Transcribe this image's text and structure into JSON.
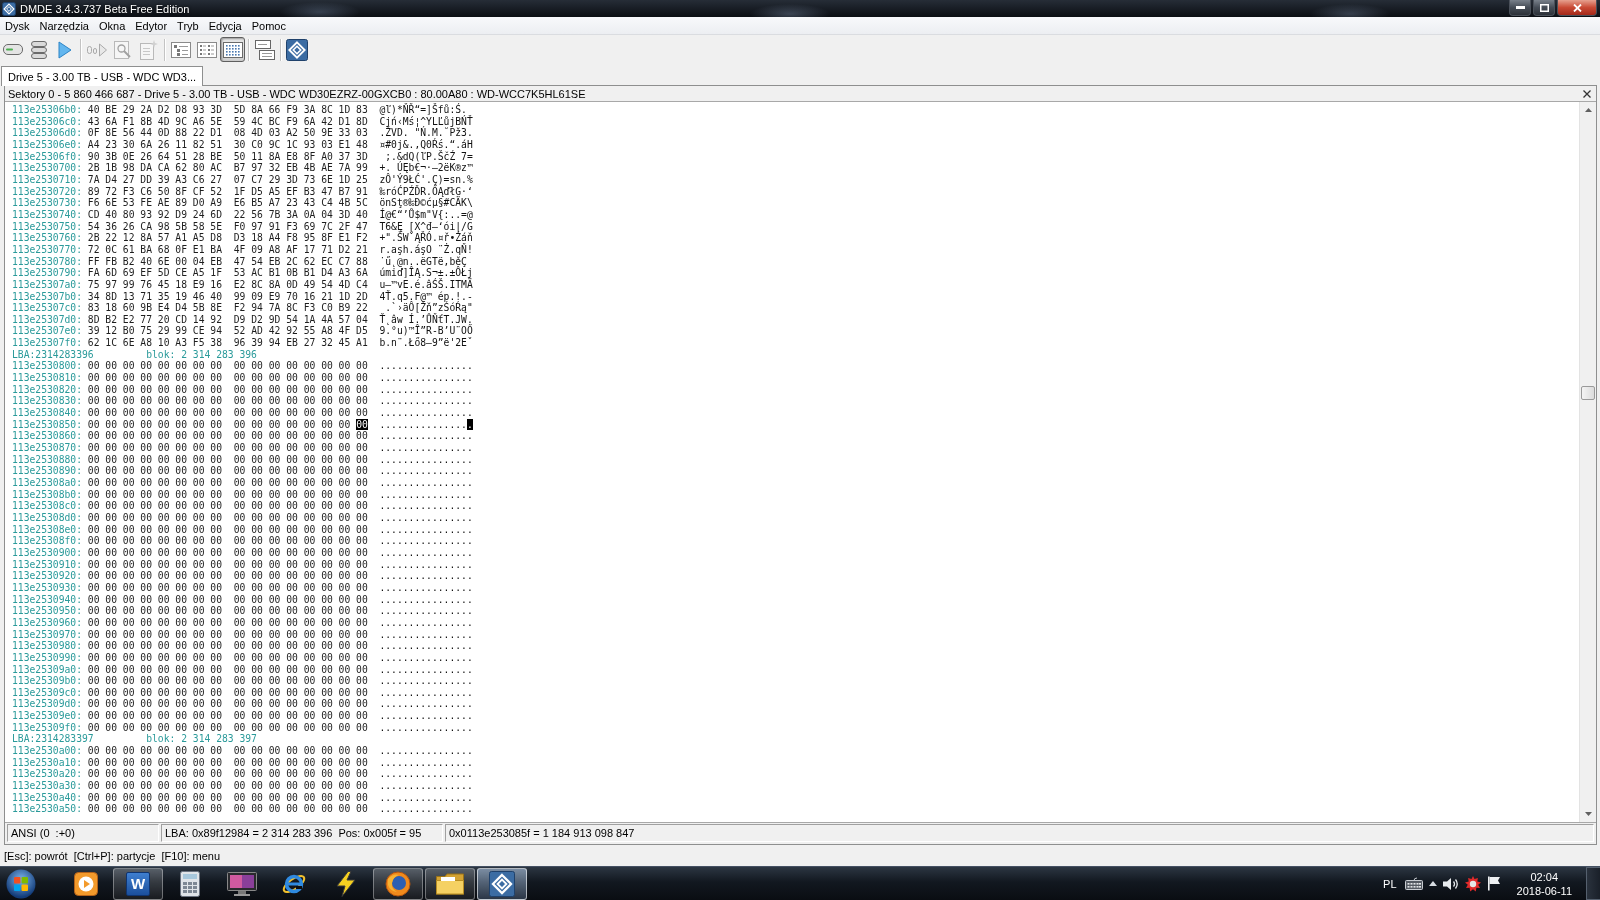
{
  "window": {
    "title": "DMDE 3.4.3.737 Beta Free Edition"
  },
  "menu": [
    "Dysk",
    "Narzędzia",
    "Okna",
    "Edytor",
    "Tryb",
    "Edycja",
    "Pomoc"
  ],
  "toolbar": [
    {
      "buttons": [
        {
          "disabled": false,
          "pressed": false
        },
        {
          "disabled": false,
          "pressed": false
        },
        {
          "disabled": false,
          "pressed": false
        }
      ]
    },
    {
      "buttons": [
        {
          "disabled": true,
          "pressed": false
        },
        {
          "disabled": true,
          "pressed": false
        },
        {
          "disabled": true,
          "pressed": false
        }
      ]
    },
    {
      "buttons": [
        {
          "disabled": false,
          "pressed": false
        },
        {
          "disabled": false,
          "pressed": false
        },
        {
          "disabled": false,
          "pressed": true
        }
      ]
    },
    {
      "buttons": [
        {
          "disabled": false,
          "pressed": false
        }
      ]
    },
    {
      "buttons": [
        {
          "disabled": false,
          "pressed": false
        }
      ]
    }
  ],
  "tabs": [
    {
      "label": "Drive 5 - 3.00 TB - USB - WDC WD3...",
      "selected": true
    }
  ],
  "panel": {
    "title": "Sektory 0 - 5 860 466 687 - Drive 5 - 3.00 TB - USB - WDC WD30EZRZ-00GXCB0 : 80.00A80 : WD-WCC7K5HL61SE",
    "rows": [
      {
        "kind": "data",
        "address": "113e25306b0:",
        "hex": [
          "40 BE 29 2A D2 D8 93 3D",
          "5D 8A 66 F9 3A 8C 1D 83"
        ],
        "ascii": "@ľ)*ŇŘ“=]Šfů:Ś."
      },
      {
        "kind": "data",
        "address": "113e25306c0:",
        "hex": [
          "43 6A F1 8B 4D 9C A6 5E",
          "59 4C BC F9 6A 42 D1 8D"
        ],
        "ascii": "Cjń‹Mś¦^YLĽůjBŃŤ"
      },
      {
        "kind": "data",
        "address": "113e25306d0:",
        "hex": [
          "0F 8E 56 44 0D 88 22 D1",
          "08 4D 03 A2 50 9E 33 03"
        ],
        "ascii": ".ŽVD. \"Ń.M.˘Pž3."
      },
      {
        "kind": "data",
        "address": "113e25306e0:",
        "hex": [
          "A4 23 30 6A 26 11 82 51",
          "30 C0 9C 1C 93 03 E1 48"
        ],
        "ascii": "¤#0j&.‚Q0Ŕś.“.áH"
      },
      {
        "kind": "data",
        "address": "113e25306f0:",
        "hex": [
          "90 3B 0E 26 64 51 28 BE",
          "50 11 8A E8 8F A0 37 3D"
        ],
        "ascii": " ;.&dQ(ľP.ŠčŹ 7="
      },
      {
        "kind": "data",
        "address": "113e2530700:",
        "hex": [
          "2B 1B 98 DA CA 62 80 AC",
          "B7 97 32 EB 4B AE 7A 99"
        ],
        "ascii": "+. ÚĘb€¬·—2ëK®z™"
      },
      {
        "kind": "data",
        "address": "113e2530710:",
        "hex": [
          "7A D4 27 DD 39 A3 C6 27",
          "07 C7 29 3D 73 6E 1D 25"
        ],
        "ascii": "zÔ'Ý9ŁĆ'.Ç)=sn.%"
      },
      {
        "kind": "data",
        "address": "113e2530720:",
        "hex": [
          "89 72 F3 C6 50 8F CF 52",
          "1F D5 A5 EF B3 47 B7 91"
        ],
        "ascii": "‰róĆPŹĎR.ŐĄďłG·‘"
      },
      {
        "kind": "data",
        "address": "113e2530730:",
        "hex": [
          "F6 6E 53 FE AE 89 D0 A9",
          "E6 B5 A7 23 43 C4 4B 5C"
        ],
        "ascii": "önSţ®‰Đ©ćµ§#CÄK\\"
      },
      {
        "kind": "data",
        "address": "113e2530740:",
        "hex": [
          "CD 40 80 93 92 D9 24 6D",
          "22 56 7B 3A 0A 04 3D 40"
        ],
        "ascii": "Í@€“’Ů$m\"V{:..=@"
      },
      {
        "kind": "data",
        "address": "113e2530750:",
        "hex": [
          "54 36 26 CA 98 5B 58 5E",
          "F0 97 91 F3 69 7C 2F 47"
        ],
        "ascii": "T6&Ę [X^đ—‘ói|/G"
      },
      {
        "kind": "data",
        "address": "113e2530760:",
        "hex": [
          "2B 22 12 8A 57 A1 A5 D8",
          "D3 18 A4 F8 95 8F E1 F2"
        ],
        "ascii": "+\".ŠWˇĄŘÓ.¤ř•Źáň"
      },
      {
        "kind": "data",
        "address": "113e2530770:",
        "hex": [
          "72 0C 61 BA 68 0F E1 BA",
          "4F 09 A8 AF 17 71 D2 21"
        ],
        "ascii": "r.aşh.áşO ¨Ż.qŇ!"
      },
      {
        "kind": "data",
        "address": "113e2530780:",
        "hex": [
          "FF FB B2 40 6E 00 04 EB",
          "47 54 EB 2C 62 EC C7 88"
        ],
        "ascii": "˙ű˛@n..ëGTë,běÇ"
      },
      {
        "kind": "data",
        "address": "113e2530790:",
        "hex": [
          "FA 6D 69 EF 5D CE A5 1F",
          "53 AC B1 0B B1 D4 A3 6A"
        ],
        "ascii": "úmiď]ÎĄ.S¬±.±ÔŁj"
      },
      {
        "kind": "data",
        "address": "113e25307a0:",
        "hex": [
          "75 97 99 76 45 18 E9 16",
          "E2 8C 8A 0D 49 54 4D C4"
        ],
        "ascii": "u—™vE.é.âŚŠ.ITMÄ"
      },
      {
        "kind": "data",
        "address": "113e25307b0:",
        "hex": [
          "34 8D 13 71 35 19 46 40",
          "99 09 E9 70 16 21 1D 2D"
        ],
        "ascii": "4Ť.q5.F@™ ép.!.-"
      },
      {
        "kind": "data",
        "address": "113e25307c0:",
        "hex": [
          "83 18 60 9B E4 D4 5B 8E",
          "F2 94 7A 8C F3 C0 B9 22"
        ],
        "ascii": " .`›äÔ[Žň”zŚóŔą\""
      },
      {
        "kind": "data",
        "address": "113e25307d0:",
        "hex": [
          "8D B2 E2 77 20 CD 14 92",
          "D9 D2 9D 54 1A 4A 57 04"
        ],
        "ascii": "Ť˛âw Í.’ŮŇťT.JW."
      },
      {
        "kind": "data",
        "address": "113e25307e0:",
        "hex": [
          "39 12 B0 75 29 99 CE 94",
          "52 AD 42 92 55 A8 4F D5"
        ],
        "ascii": "9.°u)™Î”R-B’U¨OŐ"
      },
      {
        "kind": "data",
        "address": "113e25307f0:",
        "hex": [
          "62 1C 6E A8 10 A3 F5 38",
          "96 39 94 EB 27 32 45 A1"
        ],
        "ascii": "b.n¨.Łő8–9”ë'2Eˇ"
      },
      {
        "kind": "lba",
        "lba": "LBA:2314283396",
        "block": "blok: 2 314 283 396"
      },
      {
        "kind": "data",
        "address": "113e2530800:",
        "hex": [
          "00 00 00 00 00 00 00 00",
          "00 00 00 00 00 00 00 00"
        ],
        "ascii": "................"
      },
      {
        "kind": "data",
        "address": "113e2530810:",
        "hex": [
          "00 00 00 00 00 00 00 00",
          "00 00 00 00 00 00 00 00"
        ],
        "ascii": "................"
      },
      {
        "kind": "data",
        "address": "113e2530820:",
        "hex": [
          "00 00 00 00 00 00 00 00",
          "00 00 00 00 00 00 00 00"
        ],
        "ascii": "................"
      },
      {
        "kind": "data",
        "address": "113e2530830:",
        "hex": [
          "00 00 00 00 00 00 00 00",
          "00 00 00 00 00 00 00 00"
        ],
        "ascii": "................"
      },
      {
        "kind": "data",
        "address": "113e2530840:",
        "hex": [
          "00 00 00 00 00 00 00 00",
          "00 00 00 00 00 00 00 00"
        ],
        "ascii": "................"
      },
      {
        "kind": "data",
        "address": "113e2530850:",
        "hex": [
          "00 00 00 00 00 00 00 00",
          "00 00 00 00 00 00 00"
        ],
        "ascii": "...............",
        "cursor": {
          "hex": "00",
          "char": "."
        }
      },
      {
        "kind": "data",
        "address": "113e2530860:",
        "hex": [
          "00 00 00 00 00 00 00 00",
          "00 00 00 00 00 00 00 00"
        ],
        "ascii": "................"
      },
      {
        "kind": "data",
        "address": "113e2530870:",
        "hex": [
          "00 00 00 00 00 00 00 00",
          "00 00 00 00 00 00 00 00"
        ],
        "ascii": "................"
      },
      {
        "kind": "data",
        "address": "113e2530880:",
        "hex": [
          "00 00 00 00 00 00 00 00",
          "00 00 00 00 00 00 00 00"
        ],
        "ascii": "................"
      },
      {
        "kind": "data",
        "address": "113e2530890:",
        "hex": [
          "00 00 00 00 00 00 00 00",
          "00 00 00 00 00 00 00 00"
        ],
        "ascii": "................"
      },
      {
        "kind": "data",
        "address": "113e25308a0:",
        "hex": [
          "00 00 00 00 00 00 00 00",
          "00 00 00 00 00 00 00 00"
        ],
        "ascii": "................"
      },
      {
        "kind": "data",
        "address": "113e25308b0:",
        "hex": [
          "00 00 00 00 00 00 00 00",
          "00 00 00 00 00 00 00 00"
        ],
        "ascii": "................"
      },
      {
        "kind": "data",
        "address": "113e25308c0:",
        "hex": [
          "00 00 00 00 00 00 00 00",
          "00 00 00 00 00 00 00 00"
        ],
        "ascii": "................"
      },
      {
        "kind": "data",
        "address": "113e25308d0:",
        "hex": [
          "00 00 00 00 00 00 00 00",
          "00 00 00 00 00 00 00 00"
        ],
        "ascii": "................"
      },
      {
        "kind": "data",
        "address": "113e25308e0:",
        "hex": [
          "00 00 00 00 00 00 00 00",
          "00 00 00 00 00 00 00 00"
        ],
        "ascii": "................"
      },
      {
        "kind": "data",
        "address": "113e25308f0:",
        "hex": [
          "00 00 00 00 00 00 00 00",
          "00 00 00 00 00 00 00 00"
        ],
        "ascii": "................"
      },
      {
        "kind": "data",
        "address": "113e2530900:",
        "hex": [
          "00 00 00 00 00 00 00 00",
          "00 00 00 00 00 00 00 00"
        ],
        "ascii": "................"
      },
      {
        "kind": "data",
        "address": "113e2530910:",
        "hex": [
          "00 00 00 00 00 00 00 00",
          "00 00 00 00 00 00 00 00"
        ],
        "ascii": "................"
      },
      {
        "kind": "data",
        "address": "113e2530920:",
        "hex": [
          "00 00 00 00 00 00 00 00",
          "00 00 00 00 00 00 00 00"
        ],
        "ascii": "................"
      },
      {
        "kind": "data",
        "address": "113e2530930:",
        "hex": [
          "00 00 00 00 00 00 00 00",
          "00 00 00 00 00 00 00 00"
        ],
        "ascii": "................"
      },
      {
        "kind": "data",
        "address": "113e2530940:",
        "hex": [
          "00 00 00 00 00 00 00 00",
          "00 00 00 00 00 00 00 00"
        ],
        "ascii": "................"
      },
      {
        "kind": "data",
        "address": "113e2530950:",
        "hex": [
          "00 00 00 00 00 00 00 00",
          "00 00 00 00 00 00 00 00"
        ],
        "ascii": "................"
      },
      {
        "kind": "data",
        "address": "113e2530960:",
        "hex": [
          "00 00 00 00 00 00 00 00",
          "00 00 00 00 00 00 00 00"
        ],
        "ascii": "................"
      },
      {
        "kind": "data",
        "address": "113e2530970:",
        "hex": [
          "00 00 00 00 00 00 00 00",
          "00 00 00 00 00 00 00 00"
        ],
        "ascii": "................"
      },
      {
        "kind": "data",
        "address": "113e2530980:",
        "hex": [
          "00 00 00 00 00 00 00 00",
          "00 00 00 00 00 00 00 00"
        ],
        "ascii": "................"
      },
      {
        "kind": "data",
        "address": "113e2530990:",
        "hex": [
          "00 00 00 00 00 00 00 00",
          "00 00 00 00 00 00 00 00"
        ],
        "ascii": "................"
      },
      {
        "kind": "data",
        "address": "113e25309a0:",
        "hex": [
          "00 00 00 00 00 00 00 00",
          "00 00 00 00 00 00 00 00"
        ],
        "ascii": "................"
      },
      {
        "kind": "data",
        "address": "113e25309b0:",
        "hex": [
          "00 00 00 00 00 00 00 00",
          "00 00 00 00 00 00 00 00"
        ],
        "ascii": "................"
      },
      {
        "kind": "data",
        "address": "113e25309c0:",
        "hex": [
          "00 00 00 00 00 00 00 00",
          "00 00 00 00 00 00 00 00"
        ],
        "ascii": "................"
      },
      {
        "kind": "data",
        "address": "113e25309d0:",
        "hex": [
          "00 00 00 00 00 00 00 00",
          "00 00 00 00 00 00 00 00"
        ],
        "ascii": "................"
      },
      {
        "kind": "data",
        "address": "113e25309e0:",
        "hex": [
          "00 00 00 00 00 00 00 00",
          "00 00 00 00 00 00 00 00"
        ],
        "ascii": "................"
      },
      {
        "kind": "data",
        "address": "113e25309f0:",
        "hex": [
          "00 00 00 00 00 00 00 00",
          "00 00 00 00 00 00 00 00"
        ],
        "ascii": "................"
      },
      {
        "kind": "lba",
        "lba": "LBA:2314283397",
        "block": "blok: 2 314 283 397"
      },
      {
        "kind": "data",
        "address": "113e2530a00:",
        "hex": [
          "00 00 00 00 00 00 00 00",
          "00 00 00 00 00 00 00 00"
        ],
        "ascii": "................"
      },
      {
        "kind": "data",
        "address": "113e2530a10:",
        "hex": [
          "00 00 00 00 00 00 00 00",
          "00 00 00 00 00 00 00 00"
        ],
        "ascii": "................"
      },
      {
        "kind": "data",
        "address": "113e2530a20:",
        "hex": [
          "00 00 00 00 00 00 00 00",
          "00 00 00 00 00 00 00 00"
        ],
        "ascii": "................"
      },
      {
        "kind": "data",
        "address": "113e2530a30:",
        "hex": [
          "00 00 00 00 00 00 00 00",
          "00 00 00 00 00 00 00 00"
        ],
        "ascii": "................"
      },
      {
        "kind": "data",
        "address": "113e2530a40:",
        "hex": [
          "00 00 00 00 00 00 00 00",
          "00 00 00 00 00 00 00 00"
        ],
        "ascii": "................"
      },
      {
        "kind": "data",
        "address": "113e2530a50:",
        "hex": [
          "00 00 00 00 00 00 00 00",
          "00 00 00 00 00 00 00 00"
        ],
        "ascii": "................"
      }
    ],
    "status": [
      "ANSI (0  :+0)",
      "LBA: 0x89f12984 = 2 314 283 396  Pos: 0x005f = 95",
      "0x0113e253085f = 1 184 913 098 847"
    ]
  },
  "hints": "[Esc]: powrót  [Ctrl+P]: partycje  [F10]: menu",
  "taskbar": {
    "apps": [
      {
        "running": false,
        "active": false
      },
      {
        "running": true,
        "active": false,
        "logo": "W"
      },
      {
        "running": false,
        "active": false
      },
      {
        "running": false,
        "active": false
      },
      {
        "running": false,
        "active": false
      },
      {
        "running": false,
        "active": false
      },
      {
        "running": true,
        "active": false
      },
      {
        "running": true,
        "active": false
      },
      {
        "running": true,
        "active": true
      }
    ],
    "tray": {
      "language": "PL",
      "time": "02:04",
      "date": "2018-06-11"
    }
  }
}
